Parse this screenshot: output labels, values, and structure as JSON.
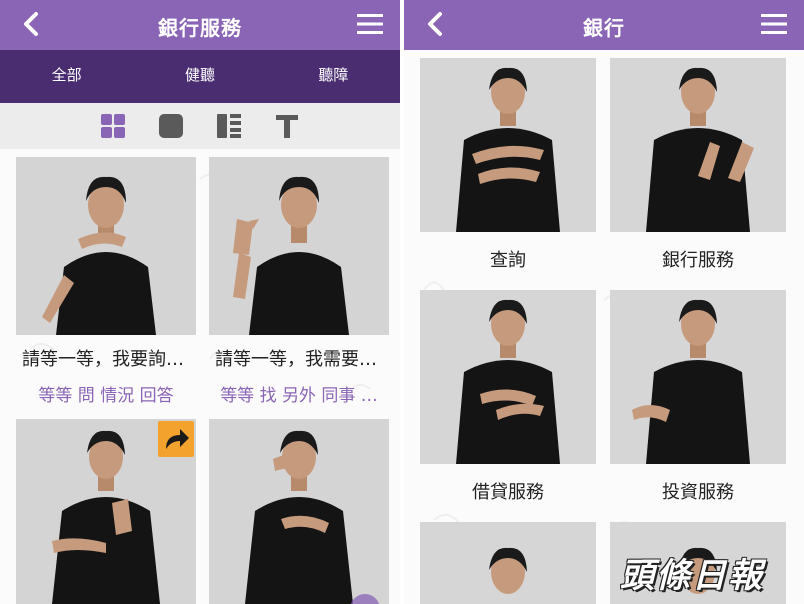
{
  "left": {
    "header": {
      "title": "銀行服務",
      "back_icon": "chevron-left-icon",
      "menu_icon": "hamburger-menu-icon"
    },
    "tabs": [
      {
        "label": "全部",
        "active": true
      },
      {
        "label": "健聽",
        "active": false
      },
      {
        "label": "聽障",
        "active": false
      }
    ],
    "view_modes": [
      {
        "icon": "grid-view-icon",
        "active": true
      },
      {
        "icon": "single-view-icon",
        "active": false
      },
      {
        "icon": "list-view-icon",
        "active": false
      },
      {
        "icon": "text-view-icon",
        "active": false
      }
    ],
    "cards": [
      {
        "caption": "請等一等，我要詢…",
        "keywords": "等等 問 情況 回答",
        "gesture": "chin"
      },
      {
        "caption": "請等一等，我需要…",
        "keywords": "等等 找 另外 同事 …",
        "gesture": "point"
      },
      {
        "caption": "",
        "keywords": "",
        "gesture": "wrist",
        "share_icon": "share-arrow-icon"
      },
      {
        "caption": "",
        "keywords": "",
        "gesture": "face"
      }
    ]
  },
  "right": {
    "header": {
      "title": "銀行",
      "back_icon": "chevron-left-icon",
      "menu_icon": "hamburger-menu-icon"
    },
    "cards": [
      {
        "caption": "查詢",
        "gesture": "cross"
      },
      {
        "caption": "銀行服務",
        "gesture": "palms"
      },
      {
        "caption": "借貸服務",
        "gesture": "low"
      },
      {
        "caption": "投資服務",
        "gesture": "single"
      },
      {
        "caption": "",
        "gesture": "none"
      },
      {
        "caption": "",
        "gesture": "none"
      }
    ]
  },
  "watermark": {
    "text": "頭條日報"
  },
  "colors": {
    "header": "#8a64b5",
    "tabbar": "#4a2d70",
    "tab_indicator": "#f3b23e",
    "keyword": "#8a64b5",
    "share": "#f3a22d"
  }
}
